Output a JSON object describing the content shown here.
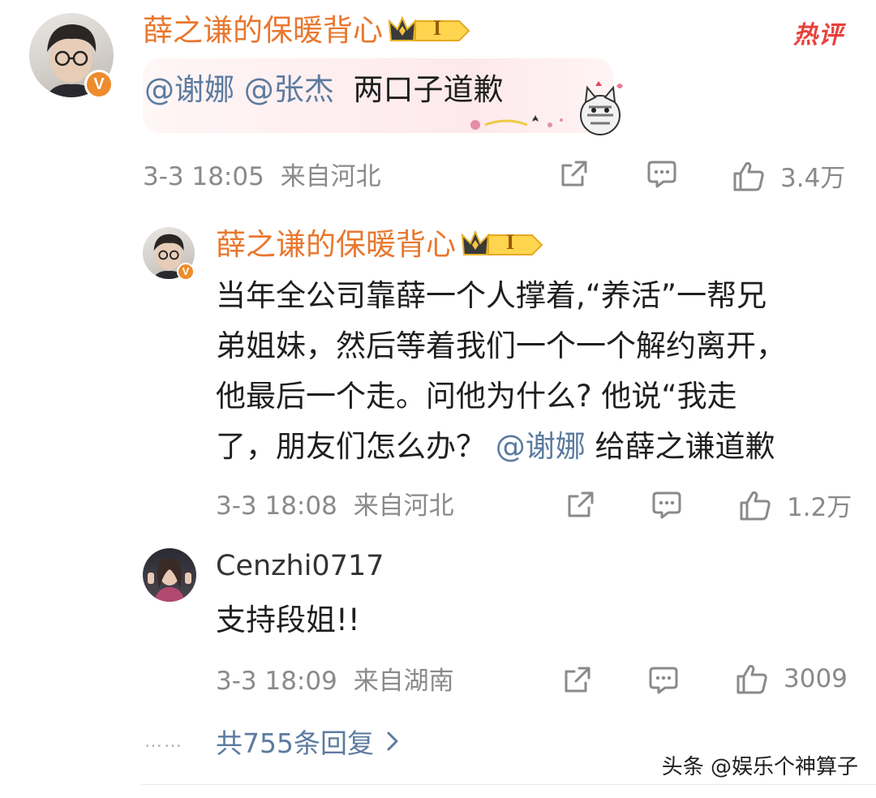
{
  "hot_label": "热评",
  "main_comment": {
    "username": "薛之谦的保暖背心",
    "fan_level": "I",
    "mentions": [
      "@谢娜",
      "@张杰"
    ],
    "text": "两口子道歉",
    "time": "3-3 18:05",
    "location": "来自河北",
    "likes": "3.4万"
  },
  "replies": [
    {
      "username": "薛之谦的保暖背心",
      "fan_level": "I",
      "text_lines": [
        "当年全公司靠薛一个人撑着,“养活”一帮兄",
        "弟姐妹，然后等着我们一个一个解约离开，",
        "他最后一个走。问他为什么? 他说“我走"
      ],
      "last_line_prefix": "了，朋友们怎么办？ ",
      "last_line_mention": "@谢娜",
      "last_line_suffix": " 给薛之谦道歉",
      "time": "3-3 18:08",
      "location": "来自河北",
      "likes": "1.2万"
    },
    {
      "username": "Cenzhi0717",
      "text": "支持段姐!!",
      "time": "3-3 18:09",
      "location": "来自湖南",
      "likes": "3009"
    }
  ],
  "more_replies": "共755条回复",
  "more_dots": "……",
  "watermark": "头条 @娱乐个神算子",
  "colors": {
    "username": "#e8782f",
    "mention": "#5c7b9f",
    "meta": "#8a8a8a",
    "hot": "#e8413c",
    "verified_badge": "#ee8b2c"
  }
}
